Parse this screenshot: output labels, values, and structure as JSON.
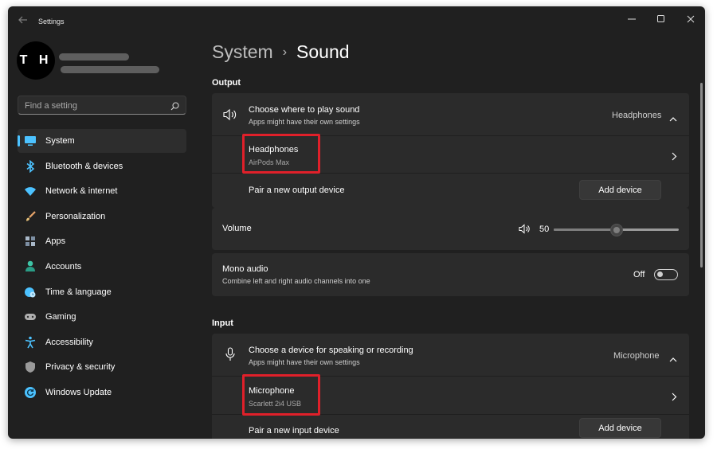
{
  "titlebar": {
    "title": "Settings",
    "icons": {
      "back": "back-arrow-icon",
      "minimize": "minimize-icon",
      "maximize": "maximize-icon",
      "close": "close-icon"
    }
  },
  "profile": {
    "avatar_initials": "T H"
  },
  "search": {
    "placeholder": "Find a setting",
    "icon": "search-icon"
  },
  "sidebar": {
    "items": [
      {
        "label": "System",
        "icon": "system-icon",
        "color": "#4cc2ff",
        "active": true
      },
      {
        "label": "Bluetooth & devices",
        "icon": "bluetooth-icon",
        "color": "#4cc2ff"
      },
      {
        "label": "Network & internet",
        "icon": "wifi-icon",
        "color": "#4cc2ff"
      },
      {
        "label": "Personalization",
        "icon": "brush-icon",
        "color": "#e8a46a"
      },
      {
        "label": "Apps",
        "icon": "apps-icon",
        "color": "#a9b8c8"
      },
      {
        "label": "Accounts",
        "icon": "account-icon",
        "color": "#3ec4a6"
      },
      {
        "label": "Time & language",
        "icon": "globe-clock-icon",
        "color": "#4cc2ff"
      },
      {
        "label": "Gaming",
        "icon": "gamepad-icon",
        "color": "#b0b0b0"
      },
      {
        "label": "Accessibility",
        "icon": "accessibility-icon",
        "color": "#4cc2ff"
      },
      {
        "label": "Privacy & security",
        "icon": "shield-icon",
        "color": "#9a9a9a"
      },
      {
        "label": "Windows Update",
        "icon": "update-icon",
        "color": "#4cc2ff"
      }
    ]
  },
  "breadcrumb": {
    "parent": "System",
    "separator": "›",
    "current": "Sound"
  },
  "output": {
    "section_label": "Output",
    "choose": {
      "title": "Choose where to play sound",
      "subtitle": "Apps might have their own settings",
      "value": "Headphones",
      "icon": "speaker-icon"
    },
    "device": {
      "name": "Headphones",
      "detail": "AirPods Max"
    },
    "pair": {
      "label": "Pair a new output device",
      "button": "Add device"
    }
  },
  "volume": {
    "label": "Volume",
    "value": "50",
    "level": 0.5,
    "icon": "volume-icon"
  },
  "mono": {
    "title": "Mono audio",
    "subtitle": "Combine left and right audio channels into one",
    "state": "Off"
  },
  "input": {
    "section_label": "Input",
    "choose": {
      "title": "Choose a device for speaking or recording",
      "subtitle": "Apps might have their own settings",
      "value": "Microphone",
      "icon": "microphone-icon"
    },
    "device": {
      "name": "Microphone",
      "detail": "Scarlett 2i4 USB"
    },
    "pair": {
      "label": "Pair a new input device",
      "button": "Add device"
    }
  },
  "colors": {
    "window_bg": "#202020",
    "card_bg": "#2b2b2b",
    "accent": "#4cc2ff",
    "highlight_box": "#e0202a"
  }
}
